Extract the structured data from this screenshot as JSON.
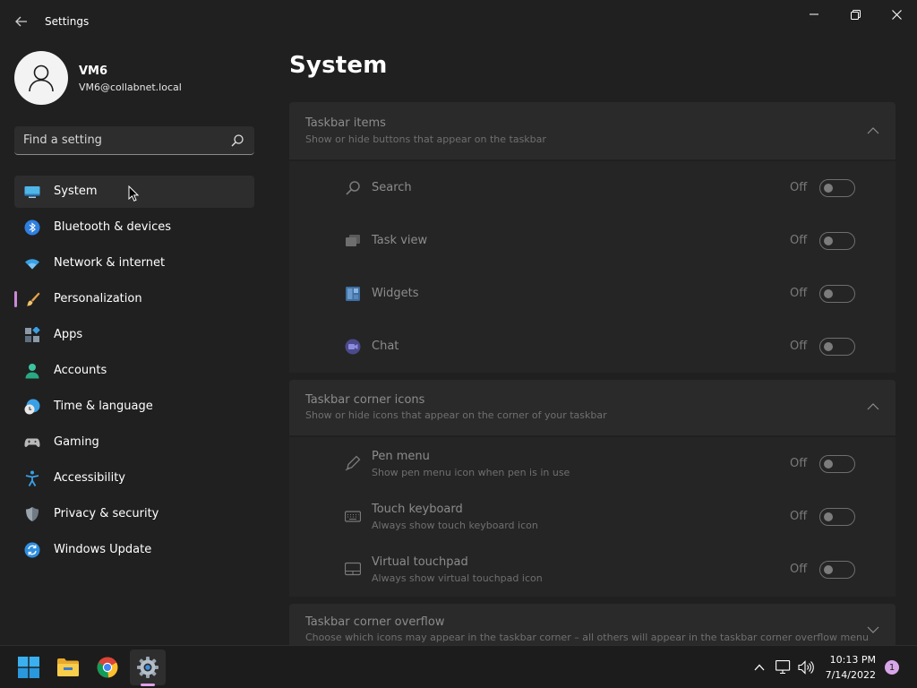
{
  "window": {
    "title": "Settings",
    "back_icon": "back-arrow-icon"
  },
  "profile": {
    "name": "VM6",
    "email": "VM6@collabnet.local"
  },
  "search": {
    "placeholder": "Find a setting"
  },
  "nav": {
    "items": [
      {
        "label": "System",
        "icon": "system-display-icon",
        "selected": true
      },
      {
        "label": "Bluetooth & devices",
        "icon": "bluetooth-icon"
      },
      {
        "label": "Network & internet",
        "icon": "wifi-icon"
      },
      {
        "label": "Personalization",
        "icon": "brush-icon"
      },
      {
        "label": "Apps",
        "icon": "apps-icon"
      },
      {
        "label": "Accounts",
        "icon": "person-icon"
      },
      {
        "label": "Time & language",
        "icon": "clock-globe-icon"
      },
      {
        "label": "Gaming",
        "icon": "gamepad-icon"
      },
      {
        "label": "Accessibility",
        "icon": "accessibility-icon"
      },
      {
        "label": "Privacy & security",
        "icon": "shield-icon"
      },
      {
        "label": "Windows Update",
        "icon": "update-icon"
      }
    ]
  },
  "content": {
    "page_title": "System",
    "taskbar_items": {
      "title": "Taskbar items",
      "subtitle": "Show or hide buttons that appear on the taskbar",
      "rows": [
        {
          "label": "Search",
          "state": "Off",
          "icon": "search-icon"
        },
        {
          "label": "Task view",
          "state": "Off",
          "icon": "task-view-icon"
        },
        {
          "label": "Widgets",
          "state": "Off",
          "icon": "widgets-icon"
        },
        {
          "label": "Chat",
          "state": "Off",
          "icon": "chat-icon"
        }
      ]
    },
    "corner_icons": {
      "title": "Taskbar corner icons",
      "subtitle": "Show or hide icons that appear on the corner of your taskbar",
      "rows": [
        {
          "label": "Pen menu",
          "desc": "Show pen menu icon when pen is in use",
          "state": "Off",
          "icon": "pen-icon"
        },
        {
          "label": "Touch keyboard",
          "desc": "Always show touch keyboard icon",
          "state": "Off",
          "icon": "keyboard-icon"
        },
        {
          "label": "Virtual touchpad",
          "desc": "Always show virtual touchpad icon",
          "state": "Off",
          "icon": "touchpad-icon"
        }
      ]
    },
    "corner_overflow": {
      "title": "Taskbar corner overflow",
      "subtitle": "Choose which icons may appear in the taskbar corner – all others will appear in the taskbar corner overflow menu"
    }
  },
  "taskbar": {
    "apps": [
      {
        "icon": "windows-start-icon"
      },
      {
        "icon": "file-explorer-icon"
      },
      {
        "icon": "chrome-icon"
      },
      {
        "icon": "settings-gear-icon",
        "active": true
      }
    ],
    "time": "10:13 PM",
    "date": "7/14/2022",
    "notifications": "1"
  },
  "colors": {
    "background": "#202020",
    "accent": "#c98ad6",
    "toggle_off_border": "#6e6e6e"
  }
}
